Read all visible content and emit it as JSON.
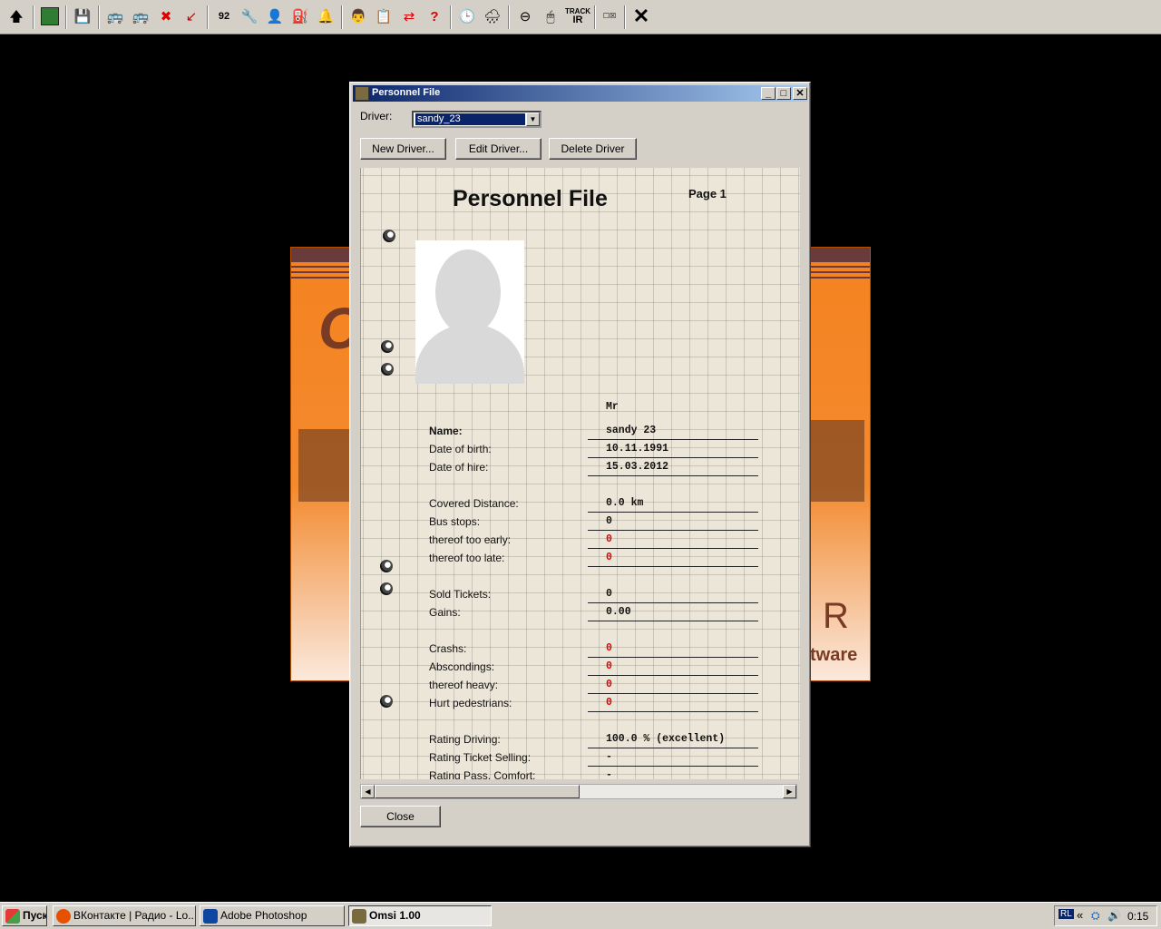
{
  "toolbar": {
    "icons": [
      "arrow-up-icon",
      "map-icon",
      "save-icon",
      "new-bus-icon",
      "bus-icon",
      "bus-remove-icon",
      "pointer-icon",
      "line-number-icon",
      "tools-icon",
      "passenger-icon",
      "fuel-icon",
      "bell-icon",
      "driver-icon",
      "timetable-icon",
      "swap-icon",
      "help-icon",
      "clock-icon",
      "weather-icon",
      "view-icon",
      "mouse-icon",
      "track-ir-icon",
      "options-icon",
      "close-x-icon"
    ],
    "track_top": "TRACK",
    "track_bottom": "IR"
  },
  "dialog": {
    "title": "Personnel File",
    "driver_label": "Driver:",
    "driver_selected": "sandy_23",
    "new_button": "New Driver...",
    "edit_button": "Edit Driver...",
    "delete_button": "Delete Driver",
    "close_button": "Close",
    "min_glyph": "_",
    "max_glyph": "□",
    "close_glyph": "✕"
  },
  "paper": {
    "title": "Personnel File",
    "page": "Page 1",
    "salutation": "Mr",
    "fields": [
      {
        "label": "Name:",
        "value": "sandy 23"
      },
      {
        "label": "Date of birth:",
        "value": "10.11.1991"
      },
      {
        "label": "Date of hire:",
        "value": "15.03.2012"
      },
      {
        "label": "Covered Distance:",
        "value": "0.0 km"
      },
      {
        "label": "Bus stops:",
        "value": "0"
      },
      {
        "label": "thereof too early:",
        "value": "0"
      },
      {
        "label": "thereof too late:",
        "value": "0"
      },
      {
        "label": "Sold Tickets:",
        "value": "0"
      },
      {
        "label": "Gains:",
        "value": "0.00"
      },
      {
        "label": "Crashs:",
        "value": "0"
      },
      {
        "label": "Abscondings:",
        "value": "0"
      },
      {
        "label": "thereof heavy:",
        "value": "0"
      },
      {
        "label": "Hurt pedestrians:",
        "value": "0"
      },
      {
        "label": "Rating Driving:",
        "value": "100.0 % (excellent)"
      },
      {
        "label": "Rating Ticket Selling:",
        "value": "-"
      },
      {
        "label": "Rating Pass. Comfort:",
        "value": "-"
      }
    ]
  },
  "splash": {
    "brand_letters": "C",
    "software": "tware",
    "mr": "R"
  },
  "taskbar": {
    "start": "Пуск",
    "tasks": [
      {
        "label": "ВКонтакте | Радио - Lo...",
        "active": false
      },
      {
        "label": "Adobe Photoshop",
        "active": false
      },
      {
        "label": "Omsi 1.00",
        "active": true
      }
    ],
    "lang": "RL",
    "chevron": "«",
    "time": "0:15"
  },
  "colors": {
    "titlebar": "#0a246a",
    "error_red": "#e00000",
    "splash_orange": "#f58220"
  }
}
